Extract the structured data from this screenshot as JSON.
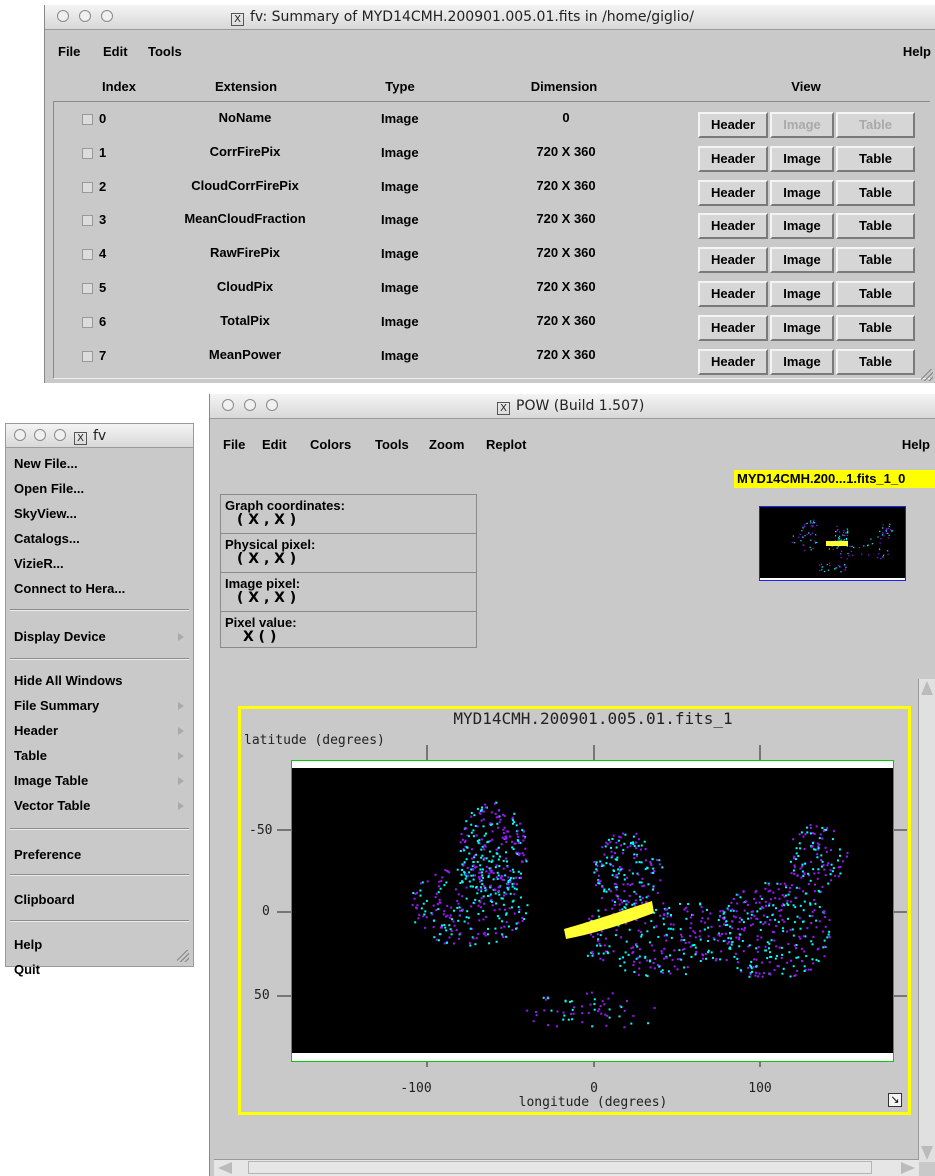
{
  "summary_window": {
    "title": "fv: Summary of MYD14CMH.200901.005.01.fits in /home/giglio/",
    "menu": {
      "file": "File",
      "edit": "Edit",
      "tools": "Tools",
      "help": "Help"
    },
    "columns": {
      "index": "Index",
      "extension": "Extension",
      "type": "Type",
      "dimension": "Dimension",
      "view": "View"
    },
    "rows": [
      {
        "index": "0",
        "extension": "NoName",
        "type": "Image",
        "dimension": "0",
        "header": "Header",
        "image": "Image",
        "table": "Table"
      },
      {
        "index": "1",
        "extension": "CorrFirePix",
        "type": "Image",
        "dimension": "720 X 360",
        "header": "Header",
        "image": "Image",
        "table": "Table"
      },
      {
        "index": "2",
        "extension": "CloudCorrFirePix",
        "type": "Image",
        "dimension": "720 X 360",
        "header": "Header",
        "image": "Image",
        "table": "Table"
      },
      {
        "index": "3",
        "extension": "MeanCloudFraction",
        "type": "Image",
        "dimension": "720 X 360",
        "header": "Header",
        "image": "Image",
        "table": "Table"
      },
      {
        "index": "4",
        "extension": "RawFirePix",
        "type": "Image",
        "dimension": "720 X 360",
        "header": "Header",
        "image": "Image",
        "table": "Table"
      },
      {
        "index": "5",
        "extension": "CloudPix",
        "type": "Image",
        "dimension": "720 X 360",
        "header": "Header",
        "image": "Image",
        "table": "Table"
      },
      {
        "index": "6",
        "extension": "TotalPix",
        "type": "Image",
        "dimension": "720 X 360",
        "header": "Header",
        "image": "Image",
        "table": "Table"
      },
      {
        "index": "7",
        "extension": "MeanPower",
        "type": "Image",
        "dimension": "720 X 360",
        "header": "Header",
        "image": "Image",
        "table": "Table"
      }
    ]
  },
  "fv_menu": {
    "title": "fv",
    "items": [
      {
        "label": "New File..."
      },
      {
        "label": "Open File..."
      },
      {
        "label": "SkyView..."
      },
      {
        "label": "Catalogs..."
      },
      {
        "label": "VizieR..."
      },
      {
        "label": "Connect to Hera..."
      },
      {
        "label": "Display Device"
      },
      {
        "label": "Hide All Windows"
      },
      {
        "label": "File Summary"
      },
      {
        "label": "Header"
      },
      {
        "label": "Table"
      },
      {
        "label": "Image Table"
      },
      {
        "label": "Vector Table"
      },
      {
        "label": "Preference"
      },
      {
        "label": "Clipboard"
      },
      {
        "label": "Help"
      },
      {
        "label": "Quit"
      }
    ]
  },
  "pow_window": {
    "title": "POW (Build 1.507)",
    "menu": {
      "file": "File",
      "edit": "Edit",
      "colors": "Colors",
      "tools": "Tools",
      "zoom": "Zoom",
      "replot": "Replot",
      "help": "Help"
    },
    "graph_tab": "MYD14CMH.200...1.fits_1_0",
    "info": {
      "graph_coords_label": "Graph coordinates:",
      "graph_coords_value": "( X , X )",
      "physical_label": "Physical pixel:",
      "physical_value": "( X , X )",
      "image_label": "Image pixel:",
      "image_value": "( X , X )",
      "pixel_value_label": "Pixel value:",
      "pixel_value_value": "X ( )"
    },
    "plot": {
      "title": "MYD14CMH.200901.005.01.fits_1",
      "ylabel": "latitude (degrees)",
      "xlabel": "longitude (degrees)",
      "x_ticks": [
        "-100",
        "0",
        "100"
      ],
      "y_ticks": [
        "-50",
        "0",
        "50"
      ]
    },
    "colors": {
      "plot_frame": "#ffff00",
      "graph_tab_bg": "#ffff00",
      "data_cyan": "#00ffff",
      "data_purple": "#9a1aff",
      "data_yellow": "#ffff33"
    }
  }
}
